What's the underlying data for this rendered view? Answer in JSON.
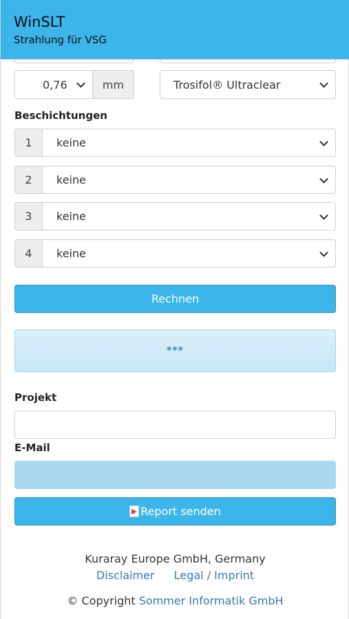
{
  "header": {
    "title": "WinSLT",
    "subtitle": "Strahlung für VSG"
  },
  "interlayer": {
    "thickness_value": "0,76",
    "thickness_unit": "mm",
    "material_value": "Trosifol® Ultraclear"
  },
  "coatings": {
    "heading": "Beschichtungen",
    "rows": [
      {
        "index": "1",
        "value": "keine"
      },
      {
        "index": "2",
        "value": "keine"
      },
      {
        "index": "3",
        "value": "keine"
      },
      {
        "index": "4",
        "value": "keine"
      }
    ]
  },
  "actions": {
    "calculate_label": "Rechnen",
    "result_text": "***",
    "send_label": "Report senden"
  },
  "form": {
    "project_label": "Projekt",
    "project_value": "",
    "email_label": "E-Mail",
    "email_value": ""
  },
  "footer": {
    "company": "Kuraray Europe GmbH, Germany",
    "disclaimer_link": "Disclaimer",
    "imprint_link": "Legal / Imprint",
    "copyright_prefix": "© Copyright",
    "copyright_link": "Sommer Informatik GmbH"
  },
  "colors": {
    "header_bg": "#3cb6ea",
    "button_bg": "#3cb6ea",
    "link": "#337ab7",
    "email_fill": "#a9d8f3"
  }
}
